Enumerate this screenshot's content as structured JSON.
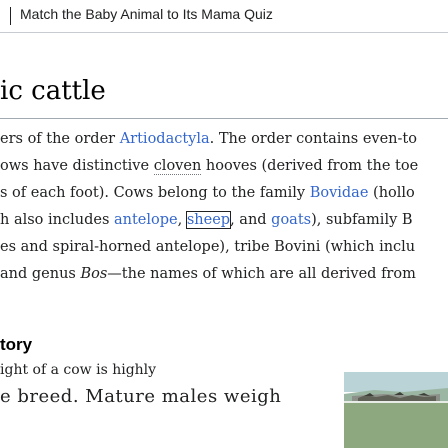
{
  "banner": {
    "quiz_link": "Match the Baby Animal to Its Mama Quiz"
  },
  "section": {
    "heading": "ic cattle"
  },
  "paragraph": {
    "line1": [
      {
        "t": "ers of the order ",
        "link": false
      },
      {
        "t": "Artiodactyla",
        "link": true
      },
      {
        "t": ". The order contains even-to",
        "link": false
      }
    ],
    "line2": [
      {
        "t": "ows have distinctive ",
        "link": false
      },
      {
        "t": "cloven",
        "link": "cloven"
      },
      {
        "t": " hooves (derived from the toe",
        "link": false
      }
    ],
    "line3": [
      {
        "t": "s of each foot). Cows belong to the family ",
        "link": false
      },
      {
        "t": "Bovidae",
        "link": true
      },
      {
        "t": " (hollo",
        "link": false
      }
    ],
    "line4": [
      {
        "t": "h also includes ",
        "link": false
      },
      {
        "t": "antelope",
        "link": true
      },
      {
        "t": ", ",
        "link": false
      },
      {
        "t": "sheep",
        "link": "sheep"
      },
      {
        "t": ", and ",
        "link": false
      },
      {
        "t": "goats",
        "link": true
      },
      {
        "t": "), subfamily B",
        "link": false
      }
    ],
    "line5": [
      {
        "t": "es and spiral-horned antelope), tribe Bovini (which inclu",
        "link": false
      }
    ],
    "line6": [
      {
        "t": "and genus ",
        "link": false
      },
      {
        "t": "Bos",
        "link": false,
        "italic": true
      },
      {
        "t": "—the names of which are all derived from",
        "link": false
      }
    ]
  },
  "history": {
    "heading": "tory",
    "line1": "ight of a cow is highly",
    "line2": "e breed. Mature males weigh"
  },
  "colors": {
    "link": "#3366cc",
    "text": "#202122",
    "rule": "#a2a9b1"
  },
  "image": {
    "icon": "cattle-photo-thumbnail"
  }
}
